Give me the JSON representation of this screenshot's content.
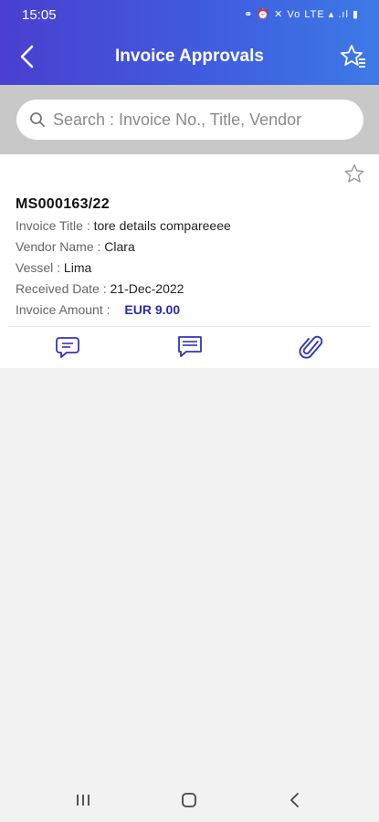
{
  "status_bar": {
    "time": "15:05",
    "icons": "⚭ ⏰ ✕ Vo LTE ▴ .ıl ▮"
  },
  "header": {
    "title": "Invoice Approvals"
  },
  "search": {
    "placeholder": "Search : Invoice No., Title, Vendor"
  },
  "invoice": {
    "number": "MS000163/22",
    "title_label": "Invoice Title :",
    "title_value": "tore details compareeee",
    "vendor_label": "Vendor Name :",
    "vendor_value": "Clara",
    "vessel_label": "Vessel :",
    "vessel_value": "Lima",
    "date_label": "Received Date :",
    "date_value": "21-Dec-2022",
    "amount_label": "Invoice Amount :",
    "amount_value": "EUR 9.00"
  },
  "actions": [
    "comments-icon",
    "message-icon",
    "attachment-icon"
  ],
  "colors": {
    "header_start": "#4a3fd0",
    "header_end": "#3d7ae6",
    "accent": "#2b2bb0"
  }
}
